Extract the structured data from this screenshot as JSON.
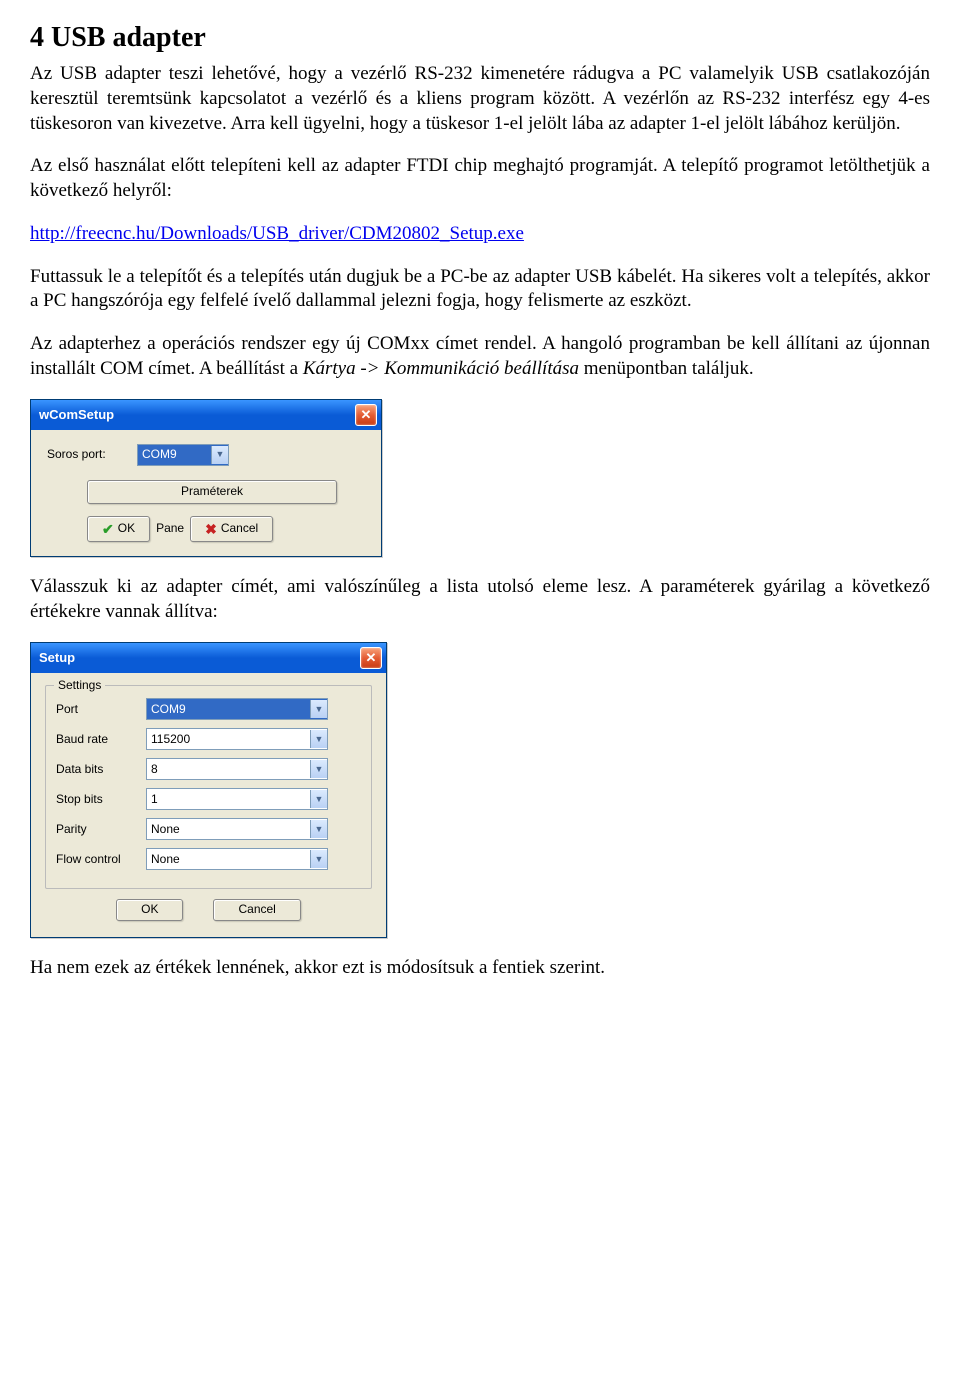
{
  "heading": "4  USB adapter",
  "para1": "Az USB adapter teszi lehetővé, hogy a vezérlő RS-232 kimenetére rádugva a PC valamelyik USB csatlakozóján keresztül teremtsünk kapcsolatot a vezérlő és a kliens program között. A vezérlőn az RS-232 interfész egy 4-es tüskesoron van kivezetve. Arra kell ügyelni, hogy a tüskesor 1-el jelölt lába az adapter 1-el jelölt lábához kerüljön.",
  "para2": "Az első használat előtt telepíteni kell az adapter FTDI chip meghajtó programját. A telepítő programot letölthetjük a következő helyről:",
  "link": "http://freecnc.hu/Downloads/USB_driver/CDM20802_Setup.exe",
  "para3": "Futtassuk le a telepítőt és a telepítés után dugjuk be a PC-be az adapter USB kábelét. Ha sikeres volt a telepítés, akkor a PC hangszórója egy felfelé ívelő dallammal jelezni fogja, hogy felismerte az eszközt.",
  "para4a": "Az adapterhez a operációs rendszer egy új COMxx címet rendel. A hangoló programban be kell állítani az újonnan installált COM címet. A beállítást a ",
  "para4b": "Kártya -> Kommunikáció beállítása",
  "para4c": " menüpontban találjuk.",
  "dialog1": {
    "title": "wComSetup",
    "port_label": "Soros port:",
    "port_value": "COM9",
    "params_btn": "Praméterek",
    "ok": "OK",
    "pane": "Pane",
    "cancel": "Cancel"
  },
  "para5": "Válasszuk ki az adapter címét, ami valószínűleg a lista utolsó eleme lesz. A paraméterek gyárilag a következő értékekre vannak állítva:",
  "dialog2": {
    "title": "Setup",
    "group": "Settings",
    "rows": [
      {
        "label": "Port",
        "value": "COM9",
        "sel": true
      },
      {
        "label": "Baud rate",
        "value": "115200",
        "sel": false
      },
      {
        "label": "Data bits",
        "value": "8",
        "sel": false
      },
      {
        "label": "Stop bits",
        "value": "1",
        "sel": false
      },
      {
        "label": "Parity",
        "value": "None",
        "sel": false
      },
      {
        "label": "Flow control",
        "value": "None",
        "sel": false
      }
    ],
    "ok": "OK",
    "cancel": "Cancel"
  },
  "para6": "Ha nem ezek az értékek lennének, akkor ezt is módosítsuk a fentiek szerint."
}
